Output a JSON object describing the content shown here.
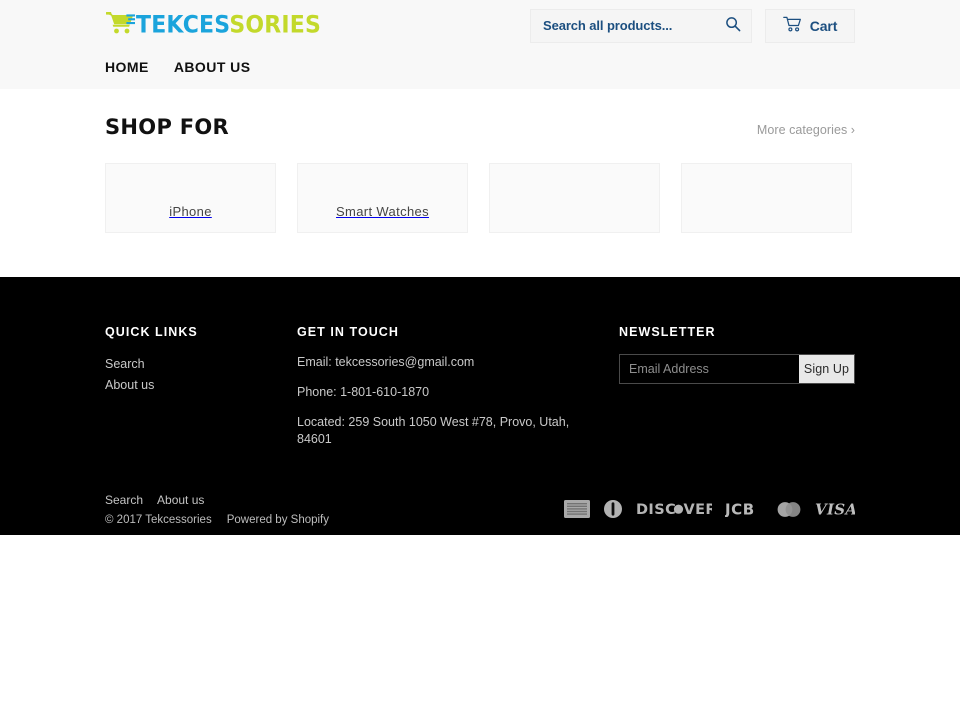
{
  "header": {
    "logo": {
      "icon": "shopping-cart-icon",
      "text_primary": "TEKCES",
      "text_secondary": "SORIES",
      "color_primary": "#1ba4dc",
      "color_secondary": "#c3d92b"
    },
    "search": {
      "placeholder": "Search all products...",
      "value": "",
      "icon": "search-icon"
    },
    "cart": {
      "label": "Cart",
      "icon": "cart-icon"
    },
    "nav": [
      {
        "label": "HOME"
      },
      {
        "label": "ABOUT US"
      }
    ]
  },
  "main": {
    "section_title": "SHOP FOR",
    "more_link": "More categories ›",
    "categories": [
      {
        "label": "iPhone"
      },
      {
        "label": "Smart Watches"
      },
      {
        "label": ""
      },
      {
        "label": ""
      }
    ]
  },
  "footer": {
    "quick_links": {
      "title": "QUICK LINKS",
      "items": [
        {
          "label": "Search"
        },
        {
          "label": "About us"
        }
      ]
    },
    "get_in_touch": {
      "title": "GET IN TOUCH",
      "email": "Email: tekcessories@gmail.com",
      "phone": "Phone: 1-801-610-1870",
      "address": "Located: 259 South 1050 West #78, Provo, Utah, 84601"
    },
    "newsletter": {
      "title": "NEWSLETTER",
      "placeholder": "Email Address",
      "value": "",
      "button": "Sign Up"
    },
    "bottom": {
      "links": [
        {
          "label": "Search"
        },
        {
          "label": "About us"
        }
      ],
      "copyright": "© 2017 Tekcessories",
      "powered_by": "Powered by Shopify",
      "payment_icons": [
        "american-express-icon",
        "diners-club-icon",
        "discover-icon",
        "jcb-icon",
        "mastercard-icon",
        "visa-icon"
      ]
    }
  }
}
